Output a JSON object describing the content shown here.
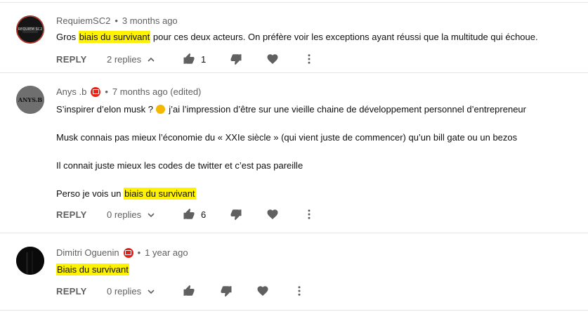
{
  "comments": [
    {
      "author": "RequiemSC2",
      "time": "3 months ago",
      "avatar_label": "REQUIEM SC2",
      "lines": [
        {
          "before": "Gros ",
          "highlight": "biais du survivant",
          "after": " pour ces deux acteurs. On préfère voir les exceptions ayant réussi que la multitude qui échoue."
        }
      ],
      "reply_label": "REPLY",
      "replies_label": "2 replies",
      "replies_expanded": true,
      "likes": "1"
    },
    {
      "author": "Anys .b",
      "time": "7 months ago (edited)",
      "avatar_label": "ANYS.B",
      "lines": [
        {
          "before": "S’inspirer d’elon musk ? ",
          "emoji": "weary-face",
          "after": " j’ai l’impression d’être sur une vieille chaine de développement personnel d’entrepreneur"
        },
        {
          "text": "Musk connais pas mieux l’économie du « XXIe siècle » (qui vient juste de commencer) qu’un bill gate ou un bezos"
        },
        {
          "text": "Il connait juste mieux les codes de twitter et c’est pas pareille"
        },
        {
          "before": "Perso je vois un ",
          "highlight": "biais du survivant",
          "after": ""
        }
      ],
      "reply_label": "REPLY",
      "replies_label": "0 replies",
      "replies_expanded": false,
      "likes": "6"
    },
    {
      "author": "Dimitri Oguenin",
      "time": "1 year ago",
      "lines": [
        {
          "before": "",
          "highlight": "Biais du survivant",
          "after": ""
        }
      ],
      "reply_label": "REPLY",
      "replies_label": "0 replies",
      "replies_expanded": false,
      "likes": ""
    }
  ],
  "colors": {
    "highlight": "#fff200",
    "badge": "#e62117",
    "meta_text": "#606060",
    "divider": "#e5e5e5"
  },
  "icons": [
    "thumbs-up-icon",
    "thumbs-down-icon",
    "heart-icon",
    "more-vert-icon",
    "chevron-up-icon",
    "chevron-down-icon",
    "membership-badge-icon"
  ]
}
